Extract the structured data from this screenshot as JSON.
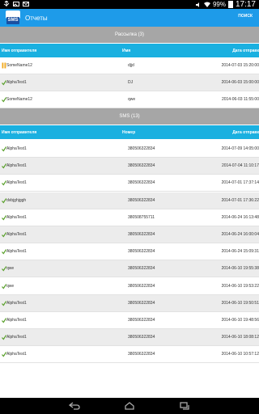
{
  "statusbar": {
    "battery_pct": "99%",
    "time": "17:17"
  },
  "actionbar": {
    "title": "Отчеты",
    "search_label": "ПОИСК",
    "logo_text": "SMS"
  },
  "sections": [
    {
      "title": "Рассылка (3)",
      "headers": [
        "Имя отправителя",
        "Имя",
        "Дата отправк"
      ],
      "rows": [
        {
          "status": "pause",
          "c1": "SomeName12",
          "c2": "djjd",
          "c3": "2014-07-03 15:20:00"
        },
        {
          "status": "check",
          "c1": "AlphaTest1",
          "c2": "DJ",
          "c3": "2014-06-03 15:00:00"
        },
        {
          "status": "check",
          "c1": "SomeName12",
          "c2": "qwe",
          "c3": "2014-06-03 11:55:00"
        }
      ]
    },
    {
      "title": "SMS (13)",
      "headers": [
        "Имя отправителя",
        "Номер",
        "Дата отправк"
      ],
      "rows": [
        {
          "status": "check",
          "c1": "AlphaTest1",
          "c2": "380506322834",
          "c3": "2014-07-09 14:05:00"
        },
        {
          "status": "check",
          "c1": "AlphaTest1",
          "c2": "380506322834",
          "c3": "2014-07-04 11:10:17"
        },
        {
          "status": "check",
          "c1": "AlphaTest1",
          "c2": "380506322834",
          "c3": "2014-07-01 17:37:14"
        },
        {
          "status": "check",
          "c1": "dvbjghjggh",
          "c2": "380506322834",
          "c3": "2014-07-01 17:36:22"
        },
        {
          "status": "check",
          "c1": "AlphaTest1",
          "c2": "380508755711",
          "c3": "2014-06-24 16:13:48"
        },
        {
          "status": "check",
          "c1": "AlphaTest1",
          "c2": "380506322834",
          "c3": "2014-06-24 16:00:04"
        },
        {
          "status": "check",
          "c1": "AlphaTest1",
          "c2": "380506322834",
          "c3": "2014-06-24 15:09:31"
        },
        {
          "status": "check",
          "c1": "qwe",
          "c2": "380506322834",
          "c3": "2014-06-10 19:55:38"
        },
        {
          "status": "check",
          "c1": "qwe",
          "c2": "380506322834",
          "c3": "2014-06-10 19:53:22"
        },
        {
          "status": "check",
          "c1": "AlphaTest1",
          "c2": "380506322834",
          "c3": "2014-06-10 19:50:51"
        },
        {
          "status": "check",
          "c1": "AlphaTest1",
          "c2": "380506322834",
          "c3": "2014-06-10 19:48:56"
        },
        {
          "status": "check",
          "c1": "AlphaTest1",
          "c2": "380506322834",
          "c3": "2014-06-10 18:08:12"
        },
        {
          "status": "check",
          "c1": "AlphaTest1",
          "c2": "380506322834",
          "c3": "2014-06-10 10:57:12"
        }
      ]
    }
  ],
  "colors": {
    "actionbar": "#1e9be9",
    "column_header": "#1ab0e0",
    "section": "#a6a6a6",
    "check": "#5aa02c",
    "pause": "#f0a81c"
  },
  "icons": {
    "check": "check-icon",
    "pause": "pause-icon",
    "back": "back-icon",
    "home": "home-icon",
    "recent": "recent-apps-icon"
  }
}
